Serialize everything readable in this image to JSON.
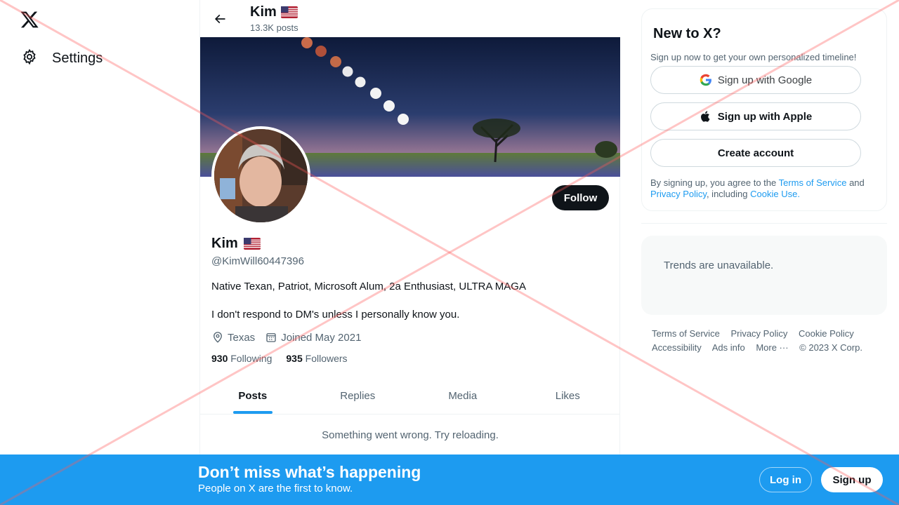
{
  "nav": {
    "settings_label": "Settings"
  },
  "header": {
    "name": "Kim",
    "posts_count": "13.3K posts"
  },
  "profile": {
    "name": "Kim",
    "handle": "@KimWill60447396",
    "follow_label": "Follow",
    "bio_line1": "Native Texan, Patriot, Microsoft Alum, 2a Enthusiast, ULTRA MAGA",
    "bio_line2": "I don't respond to DM's unless I personally know you.",
    "location": "Texas",
    "joined": "Joined May 2021",
    "following_count": "930",
    "following_label": "Following",
    "followers_count": "935",
    "followers_label": "Followers"
  },
  "tabs": [
    {
      "label": "Posts",
      "active": true
    },
    {
      "label": "Replies",
      "active": false
    },
    {
      "label": "Media",
      "active": false
    },
    {
      "label": "Likes",
      "active": false
    }
  ],
  "timeline": {
    "error": "Something went wrong. Try reloading."
  },
  "signup_card": {
    "title": "New to X?",
    "subtitle": "Sign up now to get your own personalized timeline!",
    "google_label": "Sign up with Google",
    "apple_label": "Sign up with Apple",
    "create_label": "Create account",
    "terms_prefix": "By signing up, you agree to the",
    "terms_link": "Terms of Service",
    "terms_and": "and",
    "privacy_link": "Privacy Policy",
    "terms_including": ", including",
    "cookie_link": "Cookie Use."
  },
  "trends": {
    "message": "Trends are unavailable."
  },
  "footer": {
    "links": [
      "Terms of Service",
      "Privacy Policy",
      "Cookie Policy",
      "Accessibility",
      "Ads info",
      "More ···",
      "© 2023 X Corp."
    ]
  },
  "bottom_bar": {
    "title": "Don’t miss what’s happening",
    "subtitle": "People on X are the first to know.",
    "login_label": "Log in",
    "signup_label": "Sign up"
  },
  "colors": {
    "accent": "#1d9bf0",
    "text_primary": "#0f1419",
    "text_secondary": "#536471"
  }
}
